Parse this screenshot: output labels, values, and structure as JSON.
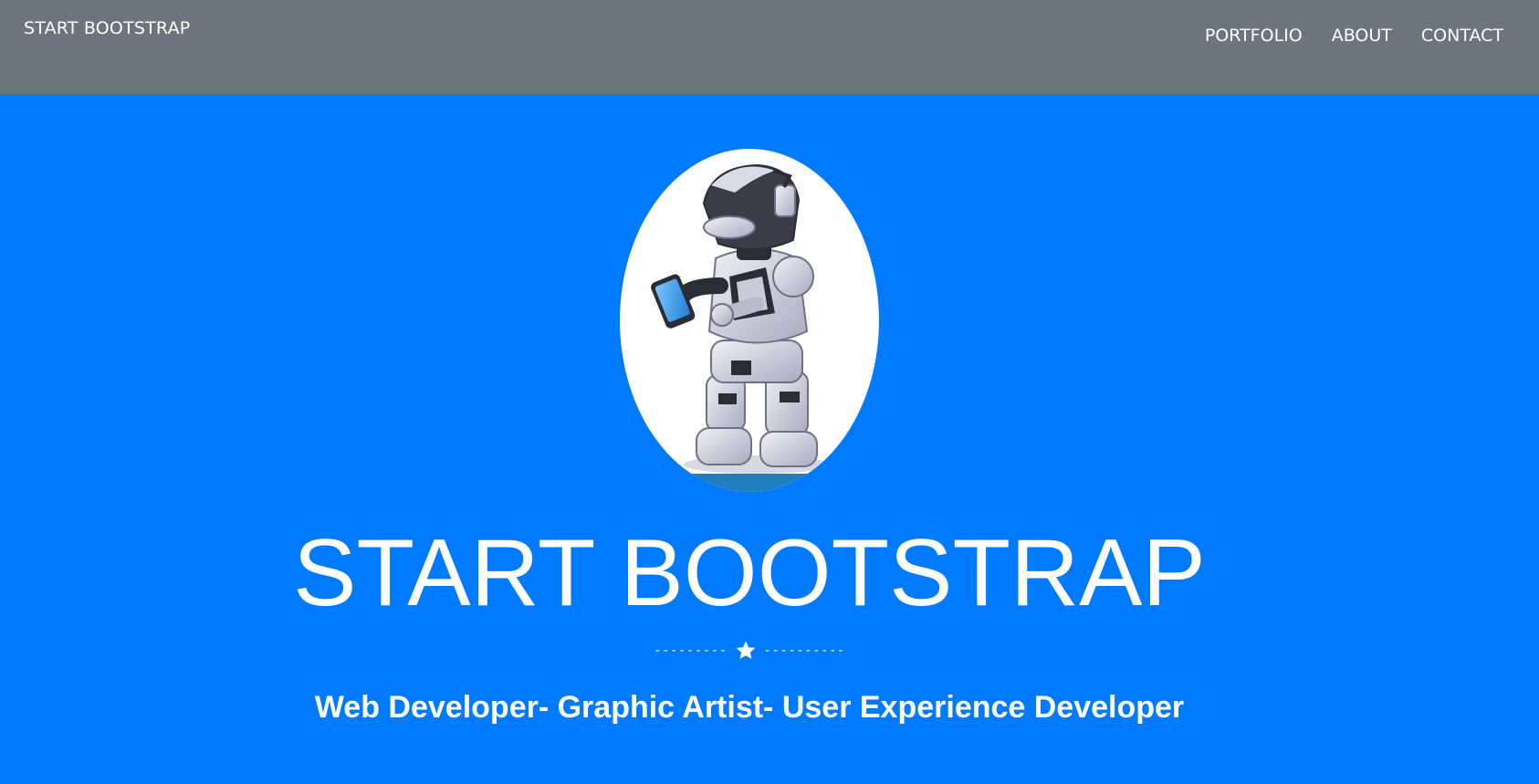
{
  "navbar": {
    "brand": "START BOOTSTRAP",
    "links": [
      "PORTFOLIO",
      "ABOUT",
      "CONTACT"
    ],
    "background": "#6c757d"
  },
  "hero": {
    "background": "#007bff",
    "avatar_icon": "robot-illustration",
    "title": "START BOOTSTRAP",
    "divider_left": "---------",
    "divider_icon": "star-icon",
    "divider_right": "----------",
    "subtitle": "Web Developer- Graphic Artist- User Experience Developer"
  }
}
